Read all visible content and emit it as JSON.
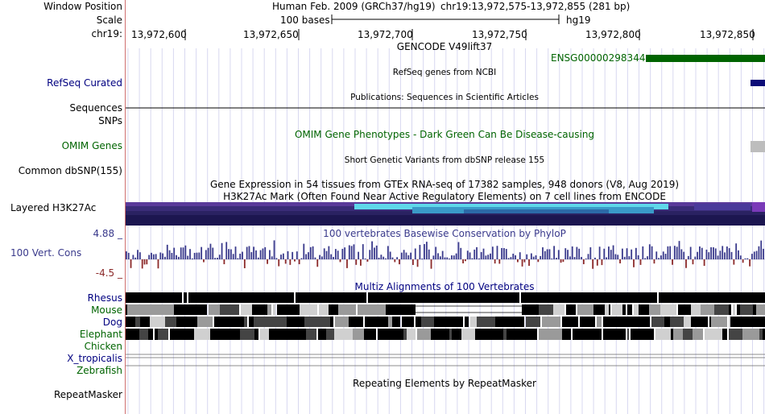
{
  "labels": {
    "window_position": "Window Position",
    "scale": "Scale",
    "chrom": "chr19:",
    "refseq": "RefSeq Curated",
    "sequences": "Sequences",
    "snps": "SNPs",
    "omim": "OMIM Genes",
    "dbsnp": "Common dbSNP(155)",
    "h3k27ac": "Layered H3K27Ac",
    "cons_max": "4.88 _",
    "cons_name": "100 Vert. Cons",
    "cons_min": "-4.5 _",
    "rhesus": "Rhesus",
    "mouse": "Mouse",
    "dog": "Dog",
    "elephant": "Elephant",
    "chicken": "Chicken",
    "xtrop": "X_tropicalis",
    "zebrafish": "Zebrafish",
    "repeatmasker": "RepeatMasker"
  },
  "header": {
    "assembly": "Human Feb. 2009 (GRCh37/hg19)",
    "position": "chr19:13,972,575-13,972,855 (281 bp)",
    "scale_text": "100 bases",
    "scale_db": "hg19",
    "ticks": [
      "13,972,600",
      "13,972,650",
      "13,972,700",
      "13,972,750",
      "13,972,800",
      "13,972,850"
    ]
  },
  "tracks": {
    "gencode_title": "GENCODE V49lift37",
    "gene_name": "ENSG00000298344",
    "refseq_title": "RefSeq genes from NCBI",
    "publications_title": "Publications: Sequences in Scientific Articles",
    "omim_title": "OMIM Gene Phenotypes - Dark Green Can Be Disease-causing",
    "dbsnp_title": "Short Genetic Variants from dbSNP release 155",
    "gtex_title": "Gene Expression in 54 tissues from GTEx RNA-seq of 17382 samples, 948 donors (V8, Aug 2019)",
    "h3k27ac_title": "H3K27Ac Mark (Often Found Near Active Regulatory Elements) on 7 cell lines from ENCODE",
    "phylop_title": "100 vertebrates Basewise Conservation by PhyloP",
    "multiz_title": "Multiz Alignments of 100 Vertebrates",
    "rmsk_title": "Repeating Elements by RepeatMasker"
  },
  "colors": {
    "gene_green": "#006400",
    "refseq_blue": "#0c0c78",
    "cons_pos": "#3a3a8c",
    "cons_neg": "#8c2a2a",
    "label_blue": "#000080",
    "label_green": "#006400",
    "grid": "#d8d8f0"
  }
}
